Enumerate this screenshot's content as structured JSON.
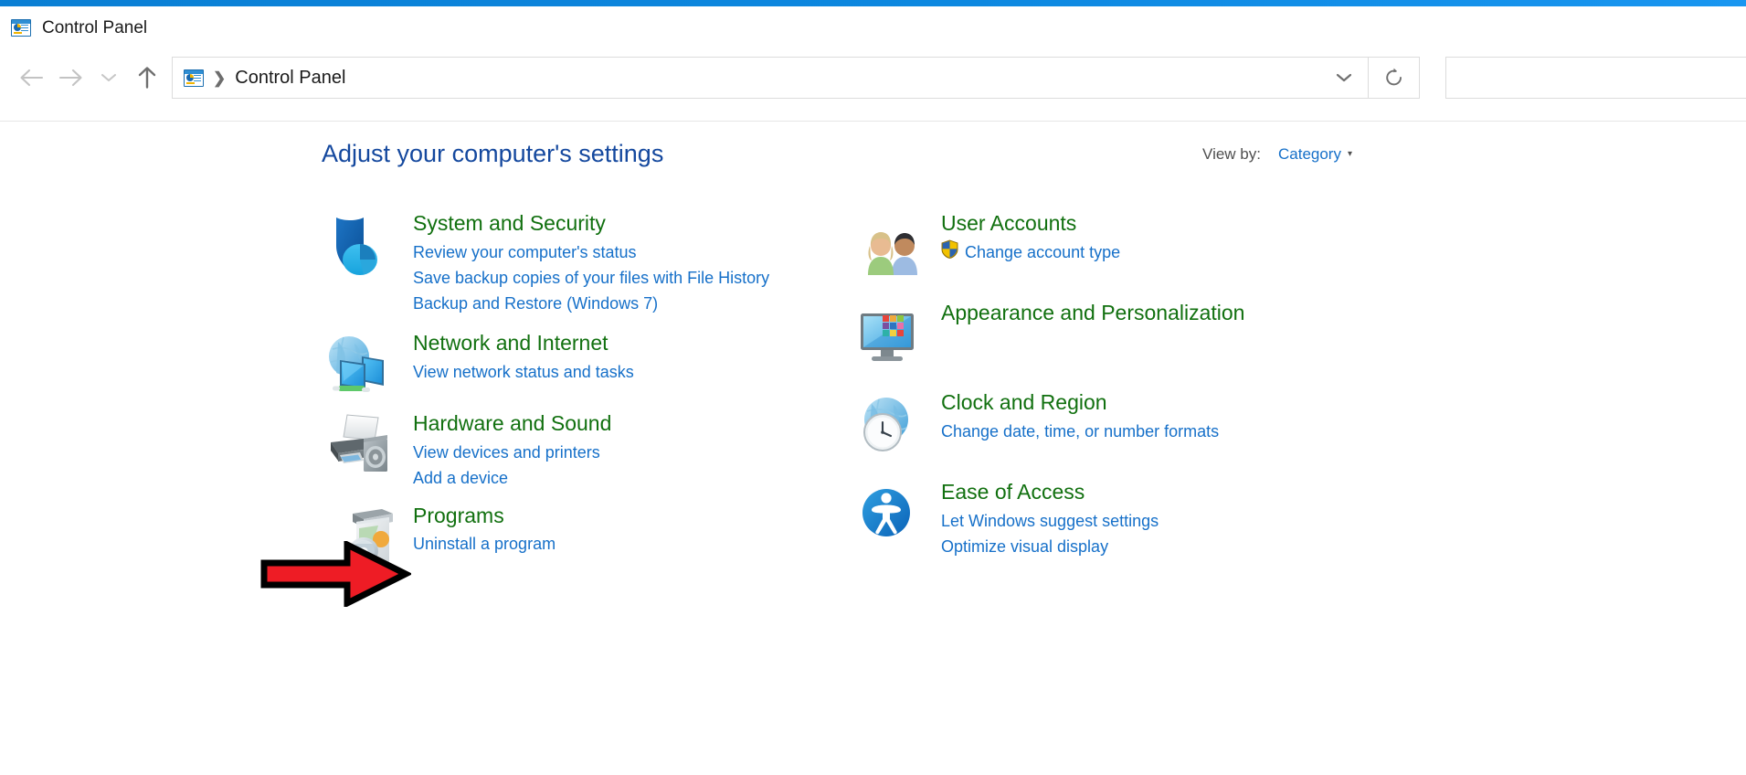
{
  "window": {
    "title": "Control Panel",
    "title_icon": "control-panel-icon",
    "accent_color": "#0d88e0"
  },
  "navigation": {
    "back_icon": "arrow-left-icon",
    "forward_icon": "arrow-right-icon",
    "recent_icon": "chevron-down-icon",
    "up_icon": "arrow-up-icon",
    "refresh_icon": "refresh-icon",
    "address_dropdown_icon": "chevron-down-icon"
  },
  "address": {
    "root_icon": "control-panel-icon",
    "separator": "❯",
    "crumb": "Control Panel"
  },
  "search": {
    "placeholder": ""
  },
  "main": {
    "heading": "Adjust your computer's settings",
    "view_by": {
      "label": "View by:",
      "value": "Category",
      "caret_icon": "chevron-down-icon"
    },
    "title_color": "#14489e",
    "category_color": "#11700f",
    "link_color": "#1670c9",
    "categories_left": [
      {
        "title": "System and Security",
        "icon": "shield-pie-icon",
        "links": [
          {
            "label": "Review your computer's status",
            "shield": false
          },
          {
            "label": "Save backup copies of your files with File History",
            "shield": false
          },
          {
            "label": "Backup and Restore (Windows 7)",
            "shield": false
          }
        ]
      },
      {
        "title": "Network and Internet",
        "icon": "globe-monitors-icon",
        "links": [
          {
            "label": "View network status and tasks",
            "shield": false
          }
        ]
      },
      {
        "title": "Hardware and Sound",
        "icon": "printer-speaker-icon",
        "links": [
          {
            "label": "View devices and printers",
            "shield": false
          },
          {
            "label": "Add a device",
            "shield": false
          }
        ]
      },
      {
        "title": "Programs",
        "icon": "software-box-cd-icon",
        "links": [
          {
            "label": "Uninstall a program",
            "shield": false
          }
        ]
      }
    ],
    "categories_right": [
      {
        "title": "User Accounts",
        "icon": "two-users-icon",
        "links": [
          {
            "label": "Change account type",
            "shield": true
          }
        ]
      },
      {
        "title": "Appearance and Personalization",
        "icon": "monitor-palette-icon",
        "links": []
      },
      {
        "title": "Clock and Region",
        "icon": "globe-clock-icon",
        "links": [
          {
            "label": "Change date, time, or number formats",
            "shield": false
          }
        ]
      },
      {
        "title": "Ease of Access",
        "icon": "ease-of-access-icon",
        "links": [
          {
            "label": "Let Windows suggest settings",
            "shield": false
          },
          {
            "label": "Optimize visual display",
            "shield": false
          }
        ]
      }
    ]
  },
  "annotation": {
    "arrow_icon": "red-right-arrow-annotation",
    "arrow_fill": "#ee1c25",
    "arrow_stroke": "#000000",
    "points_at": "Programs"
  }
}
